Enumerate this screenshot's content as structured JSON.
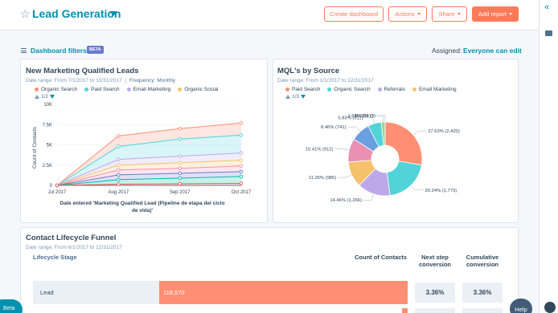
{
  "header": {
    "title": "Lead Generation",
    "buttons": {
      "create_dashboard": "Create dashboard",
      "actions": "Actions",
      "share": "Share",
      "add_report": "Add report"
    }
  },
  "filters": {
    "label": "Dashboard filters",
    "badge": "BETA",
    "assigned_label": "Assigned:",
    "assigned_value": "Everyone can edit"
  },
  "cards": {
    "mql": {
      "title": "New Marketing Qualified Leads",
      "date_range": "Date range: From 7/1/2017 to 10/31/2017",
      "frequency": "Frequency: Monthly",
      "legend": [
        {
          "label": "Organic Search",
          "color": "#ff8f73"
        },
        {
          "label": "Paid Search",
          "color": "#51d3d9"
        },
        {
          "label": "Email Marketing",
          "color": "#bda9ea"
        },
        {
          "label": "Organic Social",
          "color": "#f5c26b"
        }
      ],
      "pager": "1/2",
      "ylabel": "Count of Contacts",
      "xlabel_line1": "Date entered 'Marketing Qualified Lead (Pipeline de etapa del ciclo",
      "xlabel_line2": "de vida)'"
    },
    "source": {
      "title": "MQL's by Source",
      "date_range": "Date range: From 1/1/2017 to 12/31/2017",
      "legend": [
        {
          "label": "Paid Search",
          "color": "#ff8f73"
        },
        {
          "label": "Organic Search",
          "color": "#51d3d9"
        },
        {
          "label": "Referrals",
          "color": "#bda9ea"
        },
        {
          "label": "Email Marketing",
          "color": "#f5c26b"
        }
      ],
      "pager": "1/3"
    },
    "funnel": {
      "title": "Contact Lifecycle Funnel",
      "date_range": "Date range: From 6/1/2017 to 12/31/2017",
      "col_stage": "Lifecycle Stage",
      "col_count": "Count of Contacts",
      "col_next_1": "Next step",
      "col_next_2": "conversion",
      "col_cum_1": "Cumulative",
      "col_cum_2": "conversion",
      "rows": [
        {
          "stage": "Lead",
          "count": "118,570",
          "next": "3.36%",
          "cumulative": "3.36%"
        }
      ]
    }
  },
  "floating": {
    "beta": "Beta",
    "help": "Help"
  },
  "chart_data": [
    {
      "type": "area",
      "title": "New Marketing Qualified Leads",
      "xlabel": "Date entered 'Marketing Qualified Lead (Pipeline de etapa del ciclo de vida)'",
      "ylabel": "Count of Contacts",
      "categories": [
        "Jul 2017",
        "Aug 2017",
        "Sep 2017",
        "Oct 2017"
      ],
      "y_ticks": [
        "0",
        "2.5K",
        "5K",
        "7.5K",
        "10K"
      ],
      "ylim": [
        0,
        10000
      ],
      "stacked": true,
      "series": [
        {
          "name": "Organic Search",
          "color": "#ff8f73",
          "values": [
            0,
            6100,
            7000,
            7700
          ]
        },
        {
          "name": "Paid Search",
          "color": "#51d3d9",
          "values": [
            0,
            4800,
            5700,
            6200
          ]
        },
        {
          "name": "Email Marketing",
          "color": "#bda9ea",
          "values": [
            0,
            3200,
            3600,
            4000
          ]
        },
        {
          "name": "Organic Social",
          "color": "#f5c26b",
          "values": [
            0,
            2500,
            2800,
            3100
          ]
        },
        {
          "color": "#ff8cb0",
          "values": [
            0,
            1900,
            2100,
            2400
          ]
        },
        {
          "color": "#6a78d1",
          "values": [
            0,
            1300,
            1500,
            1700
          ]
        },
        {
          "color": "#00bda5",
          "values": [
            0,
            700,
            900,
            1100
          ]
        },
        {
          "color": "#ea5c54",
          "values": [
            0,
            150,
            200,
            250
          ]
        }
      ],
      "grid": true
    },
    {
      "type": "pie",
      "title": "MQL's by Source",
      "donut": true,
      "slices": [
        {
          "label": "27.63% (2,420)",
          "value": 27.63,
          "color": "#ff8f73"
        },
        {
          "label": "20.24% (1,773)",
          "value": 20.24,
          "color": "#51d3d9"
        },
        {
          "label": "14.46% (1,266)",
          "value": 14.46,
          "color": "#bda9ea"
        },
        {
          "label": "11.25% (985)",
          "value": 11.25,
          "color": "#f5c26b"
        },
        {
          "label": "10.41% (912)",
          "value": 10.41,
          "color": "#ea90b1"
        },
        {
          "label": "8.46% (741)",
          "value": 8.46,
          "color": "#6a9fe0"
        },
        {
          "label": "5.83% (511)",
          "value": 5.83,
          "color": "#51d3d9"
        },
        {
          "label": "1.68% (147)",
          "value": 1.68,
          "color": "#a2d28f"
        },
        {
          "label": "0.03% (3)",
          "value": 0.03,
          "color": "#ea5c54"
        }
      ]
    }
  ]
}
